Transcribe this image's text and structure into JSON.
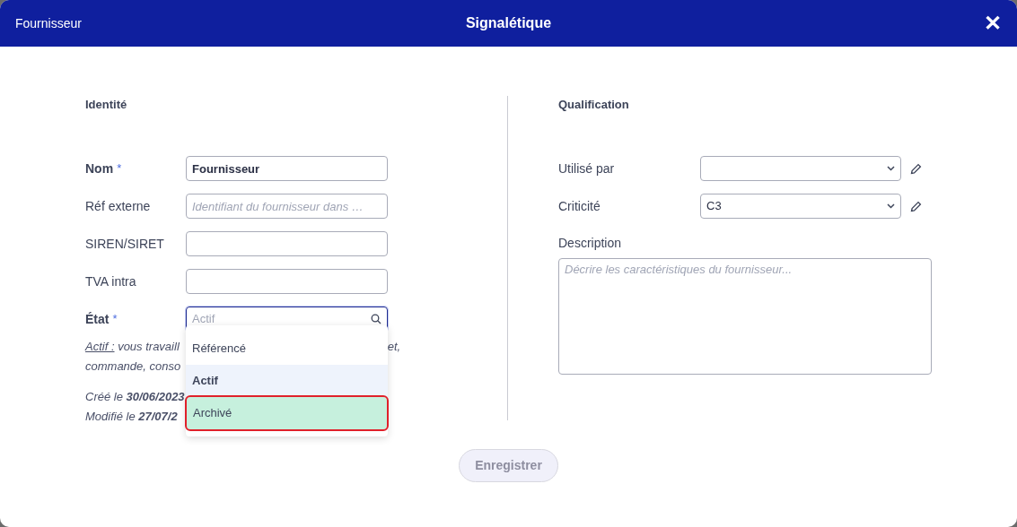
{
  "header": {
    "left": "Fournisseur",
    "title": "Signalétique",
    "close": "✕"
  },
  "identity": {
    "heading": "Identité",
    "fields": [
      {
        "label": "Nom",
        "required_mark": "*",
        "value": "Fournisseur"
      },
      {
        "label": "Réf externe",
        "placeholder": "Identifiant du fournisseur dans …"
      },
      {
        "label": "SIREN/SIRET"
      },
      {
        "label": "TVA intra"
      }
    ],
    "state": {
      "label": "État",
      "required_mark": "*",
      "placeholder": "Actif",
      "options": [
        {
          "label": "Référencé",
          "selected": false,
          "highlighted": false
        },
        {
          "label": "Actif",
          "selected": true,
          "highlighted": false
        },
        {
          "label": "Archivé",
          "selected": false,
          "highlighted": true
        }
      ]
    },
    "hint": {
      "term": "Actif :",
      "line_1": "vous travaill",
      "line_1_end": "et,",
      "line_2": "commande, conso"
    },
    "created": {
      "label": "Créé le",
      "date": "30/06/2023"
    },
    "modified": {
      "label": "Modifié le",
      "date": "27/07/2"
    }
  },
  "qualification": {
    "heading": "Qualification",
    "selects": [
      {
        "label": "Utilisé par"
      },
      {
        "label": "Criticité",
        "value": "C3"
      }
    ],
    "description": {
      "label": "Description",
      "placeholder": "Décrire les caractéristiques du fournisseur..."
    }
  },
  "save_button": {
    "label": "Enregistrer",
    "disabled": true
  }
}
